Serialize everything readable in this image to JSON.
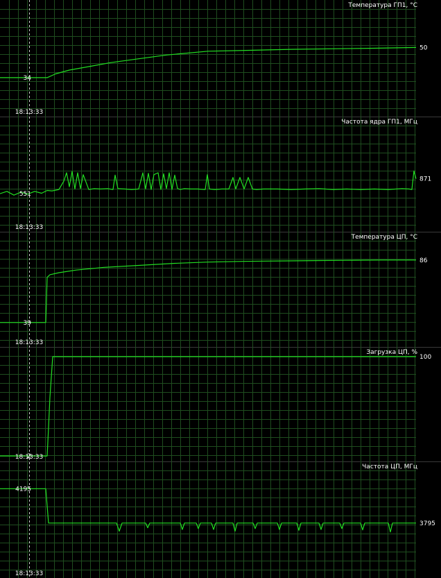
{
  "colors": {
    "background": "#000000",
    "grid": "#1f4d1f",
    "separator": "#3a3a3a",
    "series": "#22e022",
    "text": "#ffffff",
    "cursor": "#d0d0d0"
  },
  "cursor_time": "18:13:33",
  "chart_data": [
    {
      "type": "line",
      "title": "Температура ГП1, °C",
      "ylim": [
        20,
        70
      ],
      "start_label": "34",
      "end_label": "50",
      "time_label": "18:13:33",
      "series": [
        {
          "x": [
            0,
            30,
            68,
            80,
            100,
            130,
            160,
            200,
            240,
            300,
            360,
            420,
            480,
            540,
            600
          ],
          "values": [
            34,
            34,
            34,
            36,
            38,
            40,
            42,
            44,
            46,
            48,
            48.5,
            49,
            49.3,
            49.6,
            50
          ]
        }
      ]
    },
    {
      "type": "line",
      "title": "Частота ядра ГП1, МГц",
      "ylim": [
        0,
        2000
      ],
      "start_label": "551",
      "end_label": "871",
      "time_label": "18:13:33",
      "series": [
        {
          "x": [
            0,
            10,
            20,
            30,
            40,
            50,
            60,
            68,
            75,
            85,
            92,
            96,
            100,
            104,
            108,
            112,
            116,
            120,
            128,
            136,
            145,
            155,
            163,
            166,
            170,
            180,
            190,
            200,
            206,
            210,
            214,
            218,
            222,
            228,
            232,
            236,
            240,
            244,
            248,
            252,
            256,
            260,
            266,
            275,
            285,
            296,
            299,
            302,
            310,
            320,
            330,
            336,
            340,
            346,
            352,
            358,
            364,
            370,
            380,
            400,
            420,
            440,
            460,
            480,
            500,
            520,
            540,
            560,
            580,
            590,
            594,
            597,
            600
          ],
          "values": [
            551,
            600,
            520,
            580,
            540,
            600,
            560,
            620,
            610,
            640,
            820,
            1000,
            700,
            1030,
            650,
            1000,
            660,
            960,
            640,
            660,
            650,
            660,
            640,
            950,
            660,
            650,
            640,
            650,
            1000,
            650,
            990,
            640,
            960,
            1000,
            640,
            980,
            660,
            1000,
            640,
            950,
            660,
            640,
            660,
            650,
            650,
            640,
            960,
            650,
            640,
            650,
            650,
            900,
            650,
            900,
            650,
            900,
            650,
            640,
            650,
            650,
            640,
            650,
            660,
            640,
            650,
            640,
            650,
            640,
            660,
            650,
            640,
            1040,
            871
          ]
        }
      ]
    },
    {
      "type": "line",
      "title": "Температура ЦП, °C",
      "ylim": [
        30,
        100
      ],
      "start_label": "39",
      "end_label": "86",
      "time_label": "18:13:33",
      "series": [
        {
          "x": [
            0,
            20,
            40,
            66,
            68,
            72,
            85,
            110,
            150,
            200,
            250,
            300,
            350,
            400,
            450,
            500,
            550,
            600
          ],
          "values": [
            39,
            39,
            39,
            39,
            73,
            75,
            76.5,
            78.5,
            80.5,
            82,
            83.5,
            84.5,
            85,
            85.3,
            85.6,
            85.8,
            86,
            86
          ]
        }
      ]
    },
    {
      "type": "line",
      "title": "Загрузка ЦП, %",
      "ylim": [
        0,
        100
      ],
      "start_label": "2",
      "end_label": "100",
      "time_label": "18:13:33",
      "series": [
        {
          "x": [
            0,
            20,
            40,
            68,
            70,
            72,
            74,
            76,
            80,
            200,
            400,
            600
          ],
          "values": [
            2,
            2,
            2,
            2,
            30,
            60,
            80,
            100,
            100,
            100,
            100,
            100
          ]
        }
      ]
    },
    {
      "type": "line",
      "title": "Частота ЦП, МГц",
      "ylim": [
        3300,
        4400
      ],
      "start_label": "4195",
      "end_label": "3795",
      "time_label": "18:13:33",
      "series": [
        {
          "x": [
            0,
            30,
            66,
            70,
            100,
            168,
            172,
            176,
            210,
            213,
            216,
            250,
            260,
            263,
            266,
            275,
            283,
            286,
            289,
            295,
            305,
            308,
            311,
            330,
            336,
            339,
            342,
            355,
            365,
            368,
            371,
            390,
            400,
            403,
            406,
            420,
            428,
            431,
            434,
            450,
            460,
            463,
            466,
            480,
            490,
            493,
            496,
            510,
            520,
            523,
            526,
            540,
            560,
            563,
            566,
            580,
            590,
            600
          ],
          "values": [
            4195,
            4195,
            4195,
            3795,
            3795,
            3795,
            3700,
            3795,
            3795,
            3740,
            3795,
            3795,
            3795,
            3720,
            3795,
            3795,
            3795,
            3730,
            3795,
            3795,
            3795,
            3720,
            3795,
            3795,
            3795,
            3700,
            3795,
            3795,
            3795,
            3730,
            3795,
            3795,
            3795,
            3720,
            3795,
            3795,
            3795,
            3710,
            3795,
            3795,
            3795,
            3720,
            3795,
            3795,
            3795,
            3730,
            3795,
            3795,
            3795,
            3715,
            3795,
            3795,
            3795,
            3690,
            3795,
            3795,
            3795,
            3795
          ]
        }
      ]
    }
  ]
}
